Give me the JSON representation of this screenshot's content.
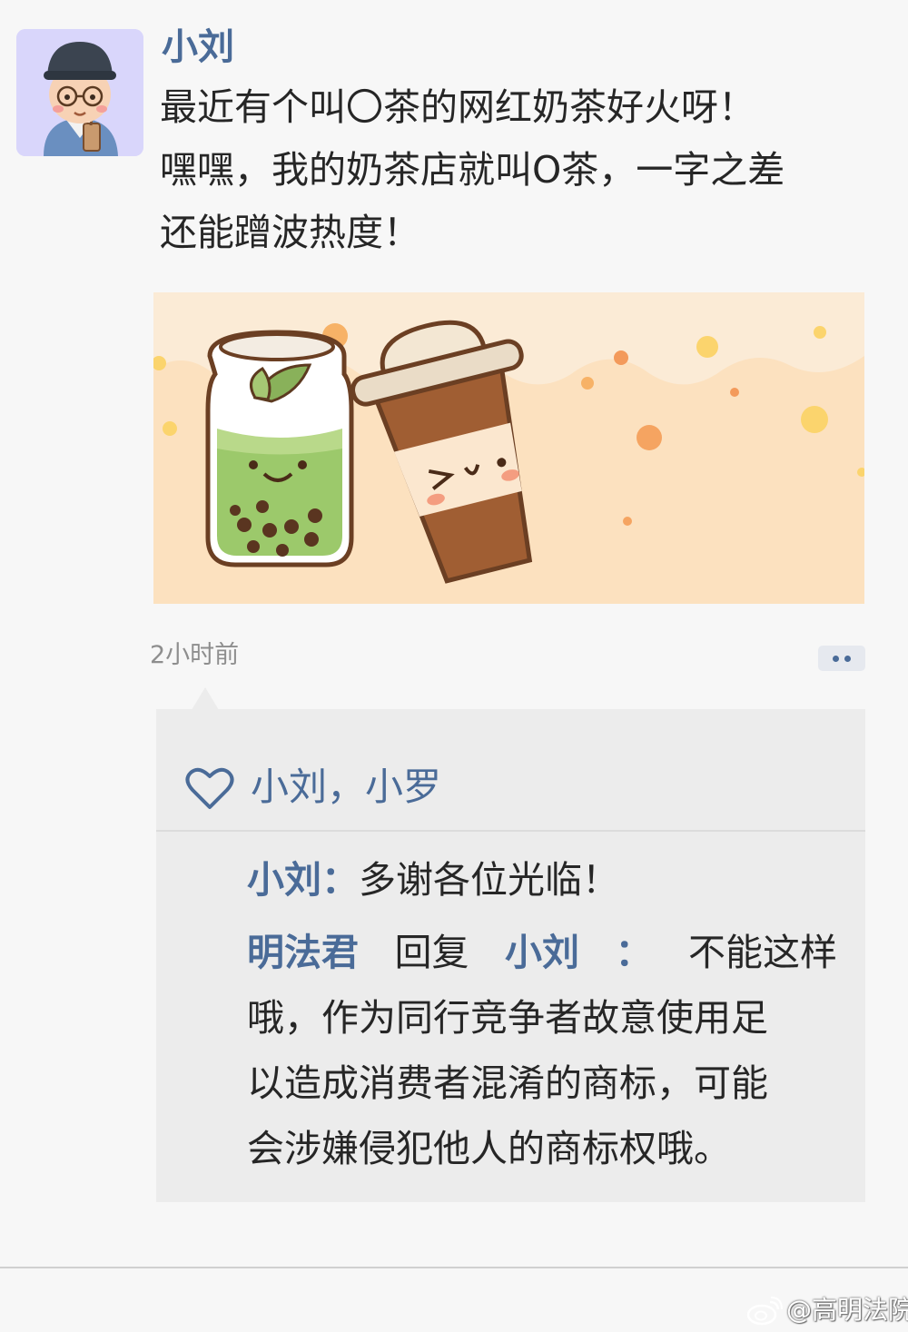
{
  "post": {
    "author": "小刘",
    "text_lines": [
      "最近有个叫〇茶的网红奶茶好火呀！",
      "嘿嘿，我的奶茶店就叫O茶，一字之差",
      "还能蹭波热度！"
    ],
    "timestamp": "2小时前"
  },
  "likes": {
    "names": "小刘，小罗"
  },
  "comments": [
    {
      "author": "小刘",
      "separator": "：",
      "text": "多谢各位光临！"
    },
    {
      "author": "明法君",
      "reply_word": "回复",
      "reply_to": "小刘",
      "separator": "：",
      "first_line_text": "不能这样",
      "text_lines": [
        "哦，作为同行竞争者故意使用足",
        "以造成消费者混淆的商标，可能",
        "会涉嫌侵犯他人的商标权哦。"
      ]
    }
  ],
  "watermark": {
    "text": "@高明法院"
  },
  "colors": {
    "name_blue": "#4a6b98",
    "text": "#262626",
    "comment_bg": "#ececec",
    "image_bg": "#fce1bf"
  },
  "icons": [
    "avatar-illustration",
    "heart-icon",
    "more-dots-icon",
    "weibo-logo-icon"
  ]
}
